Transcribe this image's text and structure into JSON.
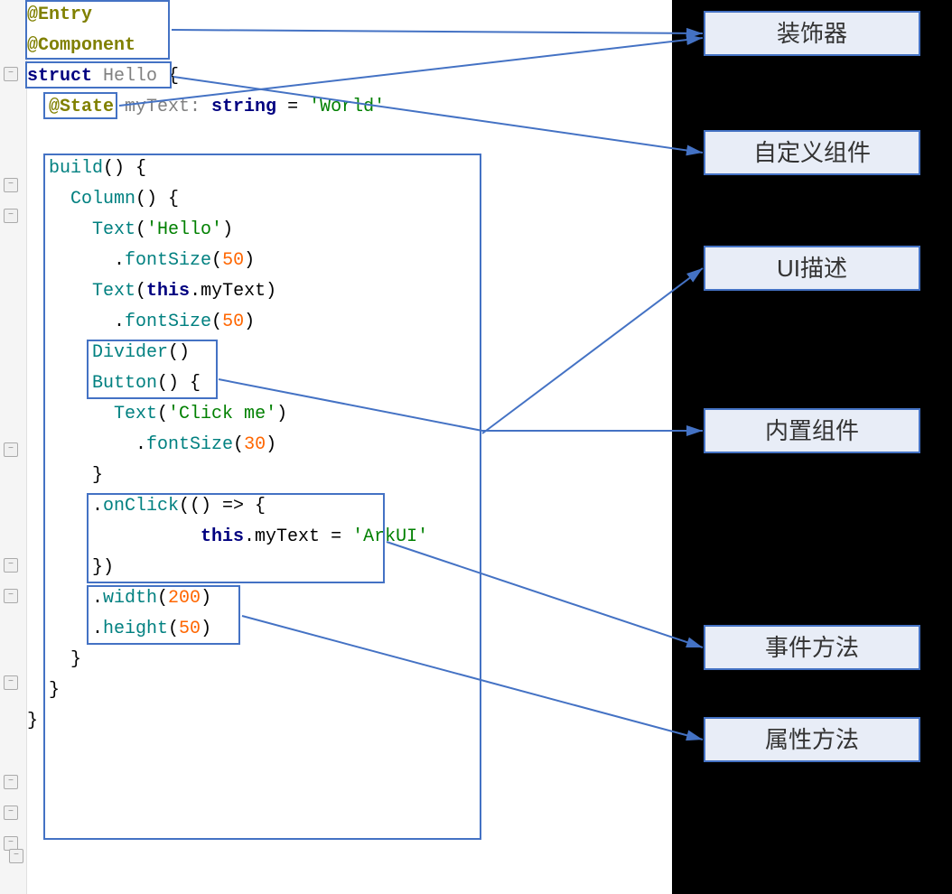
{
  "labels": {
    "decorator": "装饰器",
    "customComponent": "自定义组件",
    "uiDescription": "UI描述",
    "builtinComponent": "内置组件",
    "eventMethod": "事件方法",
    "attributeMethod": "属性方法"
  },
  "code": {
    "l1": "@Entry",
    "l2": "@Component",
    "l3a": "struct",
    "l3b": " Hello ",
    "l3c": "{",
    "l4a": "  @State",
    "l4b": " myText: ",
    "l4c": "string",
    "l4d": " = ",
    "l4e": "'World'",
    "l6a": "  build",
    "l6b": "() {",
    "l7a": "    Column",
    "l7b": "() {",
    "l8a": "      Text",
    "l8b": "(",
    "l8c": "'Hello'",
    "l8d": ")",
    "l9a": "        .",
    "l9b": "fontSize",
    "l9c": "(",
    "l9n": "50",
    "l9d": ")",
    "l10a": "      Text",
    "l10b": "(",
    "l10c": "this",
    "l10d": ".myText)",
    "l11a": "        .",
    "l11b": "fontSize",
    "l11c": "(",
    "l11n": "50",
    "l11d": ")",
    "l12a": "      Divider",
    "l12b": "()",
    "l13a": "      Button",
    "l13b": "() {",
    "l14a": "        Text",
    "l14b": "(",
    "l14c": "'Click me'",
    "l14d": ")",
    "l15a": "          .",
    "l15b": "fontSize",
    "l15c": "(",
    "l15n": "30",
    "l15d": ")",
    "l16": "      }",
    "l17a": "      .",
    "l17b": "onClick",
    "l17c": "(() => {",
    "l18a": "        this",
    "l18b": ".myText = ",
    "l18c": "'ArkUI'",
    "l19": "      })",
    "l20a": "      .",
    "l20b": "width",
    "l20c": "(",
    "l20n": "200",
    "l20d": ")",
    "l21a": "      .",
    "l21b": "height",
    "l21c": "(",
    "l21n": "50",
    "l21d": ")",
    "l22": "    }",
    "l23": "  }",
    "l24": "}"
  },
  "gutter": {
    "minus": "−",
    "plus": "+"
  }
}
